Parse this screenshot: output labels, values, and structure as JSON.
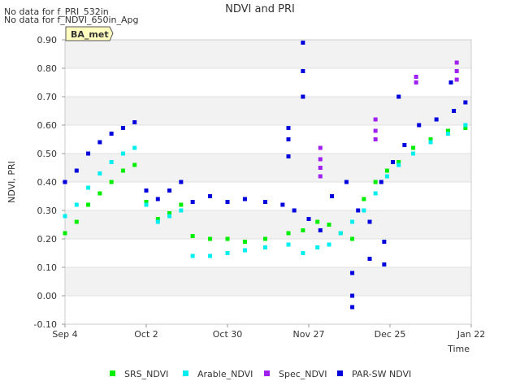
{
  "notes": [
    "No data for f_PRI_532in",
    "No data for f_NDVI_650in_Apg"
  ],
  "badge": "BA_met",
  "chart_data": {
    "type": "scatter",
    "title": "NDVI and PRI",
    "xlabel": "Time",
    "ylabel": "NDVI, PRI",
    "x_range": [
      "2022-09-04",
      "2023-01-22"
    ],
    "ylim": [
      -0.1,
      0.9
    ],
    "y_ticks": [
      "-0.10",
      "0.00",
      "0.10",
      "0.20",
      "0.30",
      "0.40",
      "0.50",
      "0.60",
      "0.70",
      "0.80",
      "0.90"
    ],
    "x_ticks": [
      {
        "label": "Sep 4",
        "date": "2022-09-04"
      },
      {
        "label": "Oct 2",
        "date": "2022-10-02"
      },
      {
        "label": "Oct 30",
        "date": "2022-10-30"
      },
      {
        "label": "Nov 27",
        "date": "2022-11-27"
      },
      {
        "label": "Dec 25",
        "date": "2022-12-25"
      },
      {
        "label": "Jan 22",
        "date": "2023-01-22"
      }
    ],
    "grid": "horizontal bands",
    "legend_position": "bottom",
    "series": [
      {
        "name": "SRS_NDVI",
        "color": "#00ee00",
        "points": [
          [
            "2022-09-04",
            0.22
          ],
          [
            "2022-09-08",
            0.26
          ],
          [
            "2022-09-12",
            0.32
          ],
          [
            "2022-09-16",
            0.36
          ],
          [
            "2022-09-20",
            0.4
          ],
          [
            "2022-09-24",
            0.44
          ],
          [
            "2022-09-28",
            0.46
          ],
          [
            "2022-10-02",
            0.33
          ],
          [
            "2022-10-06",
            0.27
          ],
          [
            "2022-10-10",
            0.29
          ],
          [
            "2022-10-14",
            0.32
          ],
          [
            "2022-10-18",
            0.21
          ],
          [
            "2022-10-24",
            0.2
          ],
          [
            "2022-10-30",
            0.2
          ],
          [
            "2022-11-05",
            0.19
          ],
          [
            "2022-11-12",
            0.2
          ],
          [
            "2022-11-20",
            0.22
          ],
          [
            "2022-11-25",
            0.23
          ],
          [
            "2022-11-30",
            0.26
          ],
          [
            "2022-12-04",
            0.25
          ],
          [
            "2022-12-08",
            0.22
          ],
          [
            "2022-12-12",
            0.2
          ],
          [
            "2022-12-16",
            0.34
          ],
          [
            "2022-12-20",
            0.4
          ],
          [
            "2022-12-24",
            0.44
          ],
          [
            "2022-12-28",
            0.47
          ],
          [
            "2023-01-02",
            0.52
          ],
          [
            "2023-01-08",
            0.55
          ],
          [
            "2023-01-14",
            0.58
          ],
          [
            "2023-01-20",
            0.59
          ]
        ]
      },
      {
        "name": "Arable_NDVI",
        "color": "#00eeee",
        "points": [
          [
            "2022-09-04",
            0.28
          ],
          [
            "2022-09-08",
            0.32
          ],
          [
            "2022-09-12",
            0.38
          ],
          [
            "2022-09-16",
            0.43
          ],
          [
            "2022-09-20",
            0.47
          ],
          [
            "2022-09-24",
            0.5
          ],
          [
            "2022-09-28",
            0.52
          ],
          [
            "2022-10-02",
            0.32
          ],
          [
            "2022-10-06",
            0.26
          ],
          [
            "2022-10-10",
            0.28
          ],
          [
            "2022-10-14",
            0.3
          ],
          [
            "2022-10-18",
            0.14
          ],
          [
            "2022-10-24",
            0.14
          ],
          [
            "2022-10-30",
            0.15
          ],
          [
            "2022-11-05",
            0.16
          ],
          [
            "2022-11-12",
            0.17
          ],
          [
            "2022-11-20",
            0.18
          ],
          [
            "2022-11-25",
            0.15
          ],
          [
            "2022-11-30",
            0.17
          ],
          [
            "2022-12-04",
            0.18
          ],
          [
            "2022-12-08",
            0.22
          ],
          [
            "2022-12-12",
            0.26
          ],
          [
            "2022-12-16",
            0.3
          ],
          [
            "2022-12-20",
            0.36
          ],
          [
            "2022-12-24",
            0.42
          ],
          [
            "2022-12-28",
            0.46
          ],
          [
            "2023-01-02",
            0.5
          ],
          [
            "2023-01-08",
            0.54
          ],
          [
            "2023-01-14",
            0.57
          ],
          [
            "2023-01-20",
            0.6
          ]
        ]
      },
      {
        "name": "Spec_NDVI",
        "color": "#a020f0",
        "points": [
          [
            "2022-12-01",
            0.52
          ],
          [
            "2022-12-01",
            0.48
          ],
          [
            "2022-12-01",
            0.45
          ],
          [
            "2022-12-01",
            0.42
          ],
          [
            "2022-12-20",
            0.62
          ],
          [
            "2022-12-20",
            0.58
          ],
          [
            "2022-12-20",
            0.55
          ],
          [
            "2023-01-03",
            0.77
          ],
          [
            "2023-01-03",
            0.75
          ],
          [
            "2023-01-17",
            0.82
          ],
          [
            "2023-01-17",
            0.79
          ],
          [
            "2023-01-17",
            0.76
          ]
        ]
      },
      {
        "name": "PAR-SW NDVI",
        "color": "#0000dd",
        "points": [
          [
            "2022-09-04",
            0.4
          ],
          [
            "2022-09-08",
            0.44
          ],
          [
            "2022-09-12",
            0.5
          ],
          [
            "2022-09-16",
            0.54
          ],
          [
            "2022-09-20",
            0.57
          ],
          [
            "2022-09-24",
            0.59
          ],
          [
            "2022-09-28",
            0.61
          ],
          [
            "2022-10-02",
            0.37
          ],
          [
            "2022-10-06",
            0.34
          ],
          [
            "2022-10-10",
            0.37
          ],
          [
            "2022-10-14",
            0.4
          ],
          [
            "2022-10-18",
            0.33
          ],
          [
            "2022-10-24",
            0.35
          ],
          [
            "2022-10-30",
            0.33
          ],
          [
            "2022-11-05",
            0.34
          ],
          [
            "2022-11-12",
            0.33
          ],
          [
            "2022-11-18",
            0.32
          ],
          [
            "2022-11-22",
            0.3
          ],
          [
            "2022-11-27",
            0.27
          ],
          [
            "2022-12-01",
            0.23
          ],
          [
            "2022-12-05",
            0.35
          ],
          [
            "2022-12-10",
            0.4
          ],
          [
            "2022-12-14",
            0.3
          ],
          [
            "2022-12-18",
            0.26
          ],
          [
            "2022-12-22",
            0.4
          ],
          [
            "2022-12-26",
            0.47
          ],
          [
            "2022-12-30",
            0.53
          ],
          [
            "2023-01-04",
            0.6
          ],
          [
            "2023-01-10",
            0.62
          ],
          [
            "2023-01-16",
            0.65
          ],
          [
            "2023-01-20",
            0.68
          ],
          [
            "2022-11-25",
            0.89
          ],
          [
            "2022-11-25",
            0.79
          ],
          [
            "2022-11-25",
            0.7
          ],
          [
            "2022-11-20",
            0.59
          ],
          [
            "2022-11-20",
            0.55
          ],
          [
            "2022-11-20",
            0.49
          ],
          [
            "2022-12-12",
            -0.04
          ],
          [
            "2022-12-12",
            0.0
          ],
          [
            "2022-12-12",
            0.08
          ],
          [
            "2022-12-18",
            0.13
          ],
          [
            "2022-12-23",
            0.11
          ],
          [
            "2022-12-23",
            0.19
          ],
          [
            "2022-12-28",
            0.7
          ],
          [
            "2023-01-15",
            0.75
          ]
        ]
      }
    ]
  }
}
